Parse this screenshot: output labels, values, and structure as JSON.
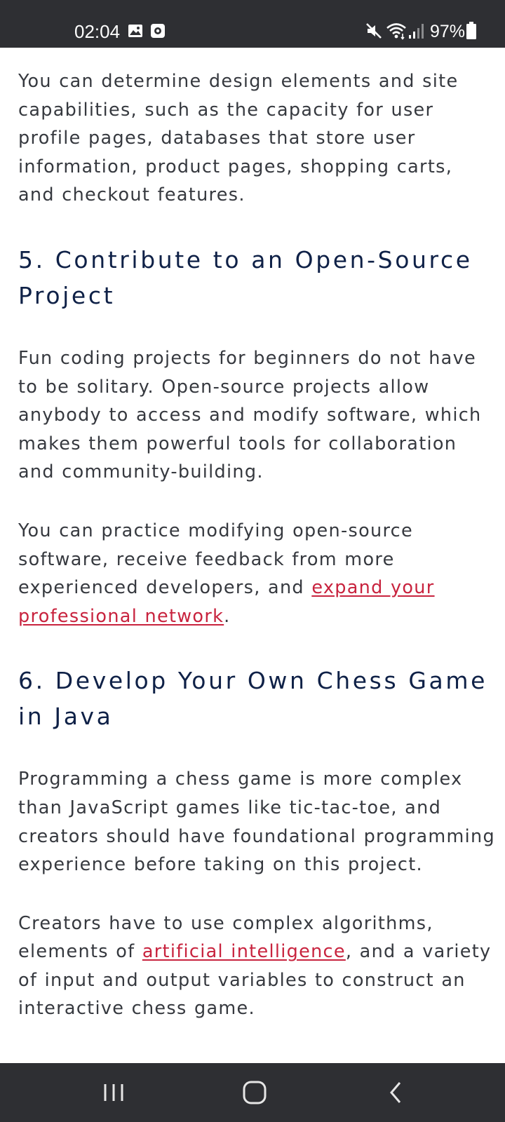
{
  "status_bar": {
    "time": "02:04",
    "battery": "97%",
    "icons": [
      "gallery-icon",
      "screen-record-icon",
      "mute-icon",
      "wifi-icon",
      "signal-icon",
      "battery-icon"
    ]
  },
  "article": {
    "p1": "You can determine design elements and site capabilities, such as the capacity for user profile pages, databases that store user information, product pages, shopping carts, and checkout features.",
    "h5": "5. Contribute to an Open-Source Project",
    "p2": "Fun coding projects for beginners do not have to be solitary. Open-source projects allow anybody to access and modify software, which makes them powerful tools for collaboration and community-building.",
    "p3_text": "You can practice modifying open-source software, receive feedback from more experienced developers, and ",
    "p3_link": "expand your professional network",
    "p3_end": ".",
    "h6": "6. Develop Your Own Chess Game in Java",
    "p4": "Programming a chess game is more complex than JavaScript games like tic-tac-toe, and creators should have foundational programming experience before taking on this project.",
    "p5_text": "Creators have to use complex algorithms, elements of ",
    "p5_link": "artificial intelligence",
    "p5_end": ", and a variety of input and output variables to construct an interactive chess game."
  },
  "nav_bar": {
    "buttons": [
      "recent-apps",
      "home",
      "back"
    ]
  },
  "colors": {
    "bars": "#2e2f33",
    "body_text": "#36393f",
    "heading": "#0f2147",
    "link": "#c8233e"
  }
}
